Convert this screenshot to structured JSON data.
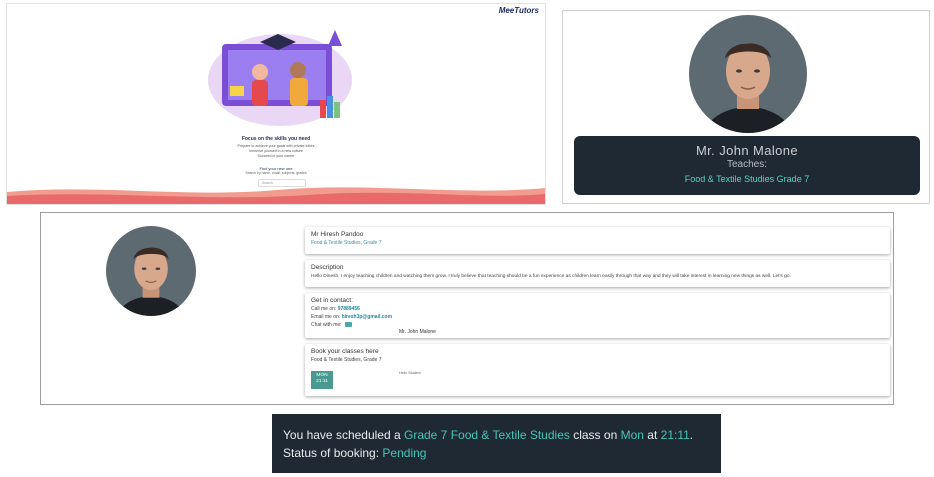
{
  "landing": {
    "brand": "MeeTutors",
    "headline": "Focus on the skills you need",
    "lines": [
      "Prepare to achieve your goals with private tutors",
      "Immerse yourself in a new culture",
      "Succeed in your career"
    ],
    "cta": "Find your new one",
    "cta_sub": "Search by name, email, subjects, grades",
    "search_placeholder": "Search"
  },
  "profile_card": {
    "name": "Mr. John Malone",
    "teaches_label": "Teaches:",
    "subject": "Food & Textile Studies Grade 7"
  },
  "tutor_detail": {
    "header": {
      "name": "Mr Hiresh Pandoo",
      "subjects": "Food & Textile Studies, Grade 7"
    },
    "description": {
      "title": "Description",
      "text": "Hello Dinesh, I enjoy teaching children and watching them grow. I truly believe that teaching should be a fun experience as children learn easily through that way and they will take interest in learning new things as well. Let's go."
    },
    "contact": {
      "title": "Get in contact:",
      "call_label": "Call me on:",
      "phone": "97889456",
      "email_label": "Email me on:",
      "email": "hiresh3p@gmail.com",
      "chat_label": "Chat with me:",
      "chat_name": "Mr. John Malone"
    },
    "booking": {
      "title": "Book your classes here",
      "subject": "Food & Textile Studies, Grade 7",
      "slot_day": "MON",
      "slot_time": "21:11",
      "note": "Hello Student"
    }
  },
  "notice": {
    "prefix": "You have scheduled a",
    "class_name": "Grade 7 Food & Textile Studies",
    "mid1": "class on",
    "day": "Mon",
    "mid2": "at",
    "time": "21:11",
    "end": ".",
    "status_label": "Status of booking:",
    "status": "Pending"
  },
  "colors": {
    "accent": "#45c5b6",
    "dark_panel": "#1f2933",
    "slot": "#4a9a91"
  }
}
